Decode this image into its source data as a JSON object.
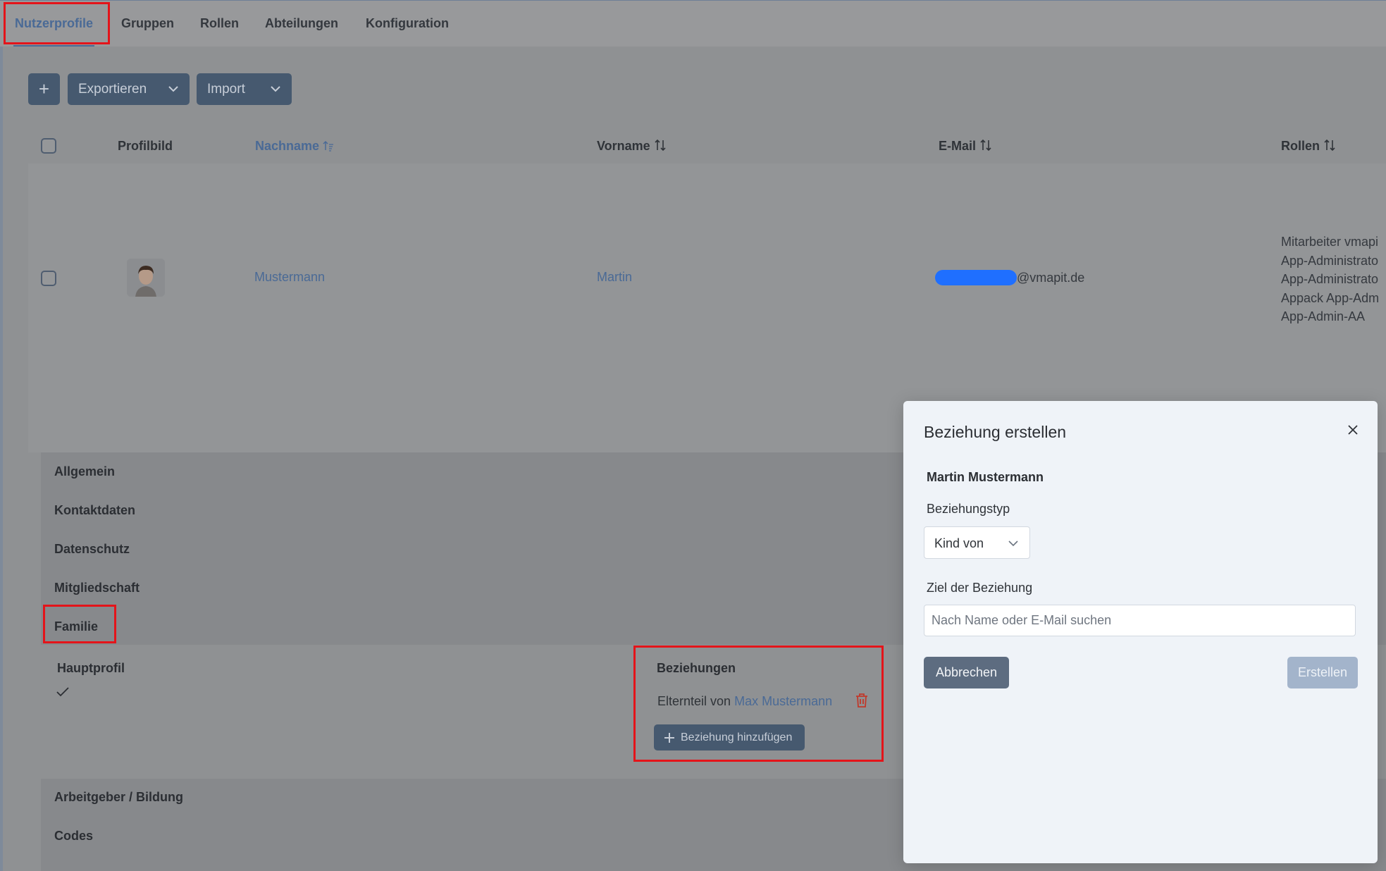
{
  "tabs": [
    {
      "label": "Nutzerprofile",
      "active": true
    },
    {
      "label": "Gruppen"
    },
    {
      "label": "Rollen"
    },
    {
      "label": "Abteilungen"
    },
    {
      "label": "Konfiguration"
    }
  ],
  "toolbar": {
    "add_label": "+",
    "export_label": "Exportieren",
    "import_label": "Import"
  },
  "table": {
    "headers": {
      "profile_picture": "Profilbild",
      "last_name": "Nachname",
      "first_name": "Vorname",
      "email": "E-Mail",
      "roles": "Rollen"
    },
    "row": {
      "last_name": "Mustermann",
      "first_name": "Martin",
      "email_visible": "@vmapit.de",
      "roles": [
        "Mitarbeiter vmapi",
        "App-Administrato",
        "App-Administrato",
        "Appack App-Adm",
        "App-Admin-AA"
      ]
    }
  },
  "accordion": {
    "sections": [
      "Allgemein",
      "Kontaktdaten",
      "Datenschutz",
      "Mitgliedschaft",
      "Familie"
    ],
    "sections_below": [
      "Arbeitgeber / Bildung",
      "Codes"
    ]
  },
  "family": {
    "main_profile_label": "Hauptprofil",
    "relations_label": "Beziehungen",
    "relation_prefix": "Elternteil von",
    "relation_target": "Max Mustermann",
    "add_relation_label": "Beziehung hinzufügen"
  },
  "modal": {
    "title": "Beziehung erstellen",
    "person": "Martin Mustermann",
    "type_label": "Beziehungstyp",
    "type_value": "Kind von",
    "target_label": "Ziel der Beziehung",
    "search_placeholder": "Nach Name oder E-Mail suchen",
    "cancel_label": "Abbrechen",
    "create_label": "Erstellen"
  },
  "colors": {
    "accent": "#4a6a96",
    "highlight": "#e4141a",
    "danger": "#c0392b",
    "redaction": "#1f6fff"
  }
}
